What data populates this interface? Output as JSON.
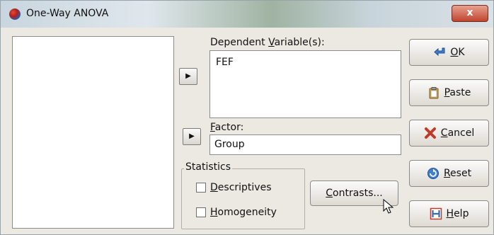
{
  "window": {
    "title": "One-Way ANOVA",
    "close_label": "x"
  },
  "dependent": {
    "label_pre": "Dependent ",
    "label_u": "V",
    "label_post": "ariable(s):",
    "items": [
      "FEF"
    ]
  },
  "factor": {
    "label_u": "F",
    "label_post": "actor:",
    "value": "Group"
  },
  "statistics": {
    "title": "Statistics",
    "descriptives": {
      "u": "D",
      "rest": "escriptives",
      "checked": false
    },
    "homogeneity": {
      "u": "H",
      "rest": "omogeneity",
      "checked": false
    }
  },
  "buttons": {
    "contrasts": {
      "u": "C",
      "rest": "ontrasts..."
    },
    "ok": {
      "u": "O",
      "rest": "K"
    },
    "paste": {
      "u": "P",
      "rest": "aste"
    },
    "cancel": {
      "u": "C",
      "rest": "ancel"
    },
    "reset": {
      "u": "R",
      "rest": "eset"
    },
    "help": {
      "u": "H",
      "rest": "elp"
    }
  },
  "icons": {
    "arrow": "▶",
    "accent_red": "#c0392b",
    "accent_blue": "#2f6fb8"
  }
}
